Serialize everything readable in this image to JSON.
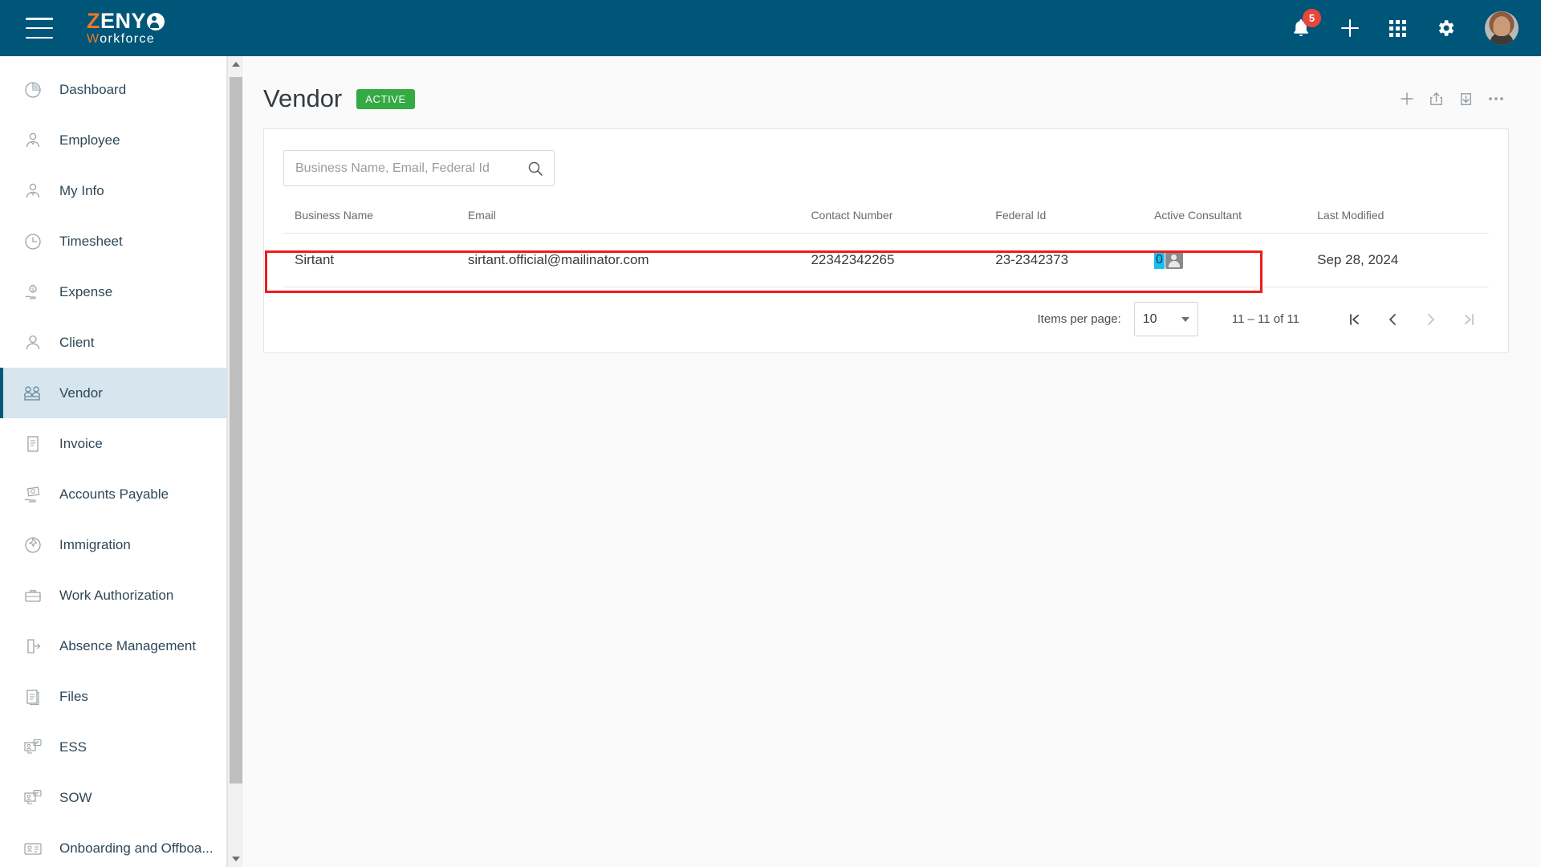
{
  "appbar": {
    "menu_icon": "hamburger-menu-icon",
    "logo": {
      "part1": "Z",
      "part2": "ENY",
      "subtitle_first": "W",
      "subtitle_rest": "orkforce"
    },
    "notifications": {
      "icon": "bell-icon",
      "badge_count": "5"
    },
    "add": {
      "icon": "plus-icon"
    },
    "apps": {
      "icon": "grid-apps-icon"
    },
    "settings": {
      "icon": "gear-icon"
    },
    "profile": {
      "icon": "avatar"
    }
  },
  "sidebar": {
    "items": [
      {
        "label": "Dashboard",
        "icon": "pie-chart-icon",
        "active": false
      },
      {
        "label": "Employee",
        "icon": "employee-icon",
        "active": false
      },
      {
        "label": "My Info",
        "icon": "my-info-icon",
        "active": false
      },
      {
        "label": "Timesheet",
        "icon": "clock-icon",
        "active": false
      },
      {
        "label": "Expense",
        "icon": "expense-hand-money-icon",
        "active": false
      },
      {
        "label": "Client",
        "icon": "person-icon",
        "active": false
      },
      {
        "label": "Vendor",
        "icon": "vendor-people-icon",
        "active": true
      },
      {
        "label": "Invoice",
        "icon": "invoice-icon",
        "active": false
      },
      {
        "label": "Accounts Payable",
        "icon": "accounts-payable-icon",
        "active": false
      },
      {
        "label": "Immigration",
        "icon": "globe-plane-icon",
        "active": false
      },
      {
        "label": "Work Authorization",
        "icon": "briefcase-icon",
        "active": false
      },
      {
        "label": "Absence Management",
        "icon": "door-exit-icon",
        "active": false
      },
      {
        "label": "Files",
        "icon": "files-icon",
        "active": false
      },
      {
        "label": "ESS",
        "icon": "ess-monitor-icon",
        "active": false
      },
      {
        "label": "SOW",
        "icon": "sow-monitor-icon",
        "active": false
      },
      {
        "label": "Onboarding and Offboa...",
        "icon": "id-card-icon",
        "active": false
      }
    ],
    "scroll_up_icon": "scroll-up-arrow-icon",
    "scroll_down_icon": "scroll-down-arrow-icon"
  },
  "page": {
    "title": "Vendor",
    "status": "ACTIVE",
    "status_color": "#33aa44",
    "actions": [
      {
        "name": "add-vendor-button",
        "icon": "plus-icon"
      },
      {
        "name": "export-button",
        "icon": "upload-share-icon"
      },
      {
        "name": "import-button",
        "icon": "download-icon"
      },
      {
        "name": "more-options-button",
        "icon": "ellipsis-icon"
      }
    ]
  },
  "search": {
    "placeholder": "Business Name, Email, Federal Id",
    "value": "",
    "icon": "search-icon"
  },
  "table": {
    "columns": [
      "Business Name",
      "Email",
      "Contact Number",
      "Federal Id",
      "Active Consultant",
      "Last Modified"
    ],
    "rows": [
      {
        "business_name": "Sirtant",
        "email": "sirtant.official@mailinator.com",
        "contact_number": "22342342265",
        "federal_id": "23-2342373",
        "active_consultant": "0",
        "last_modified": "Sep 28, 2024",
        "highlighted": true
      }
    ]
  },
  "paginator": {
    "items_per_page_label": "Items per page:",
    "items_per_page_value": "10",
    "range_label": "11 – 11 of 11",
    "first_page_icon": "first-page-icon",
    "prev_page_icon": "previous-page-icon",
    "next_page_icon": "next-page-icon",
    "last_page_icon": "last-page-icon"
  },
  "colors": {
    "appbar": "#005678",
    "accent_orange": "#ef7622",
    "active_item_bg": "#d6e5ee",
    "badge_red": "#e8453c",
    "highlight_red": "#ee1c1c",
    "consultant_highlight": "#19bdf0"
  }
}
